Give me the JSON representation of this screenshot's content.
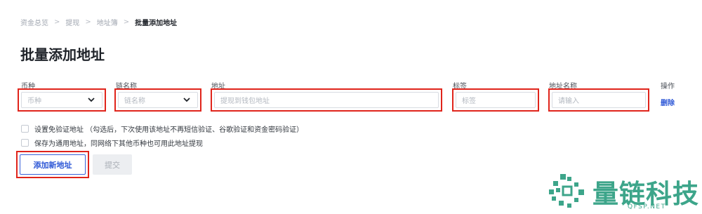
{
  "breadcrumb": {
    "items": [
      "资金总览",
      "提现",
      "地址簿"
    ],
    "separator": ">",
    "current": "批量添加地址"
  },
  "page": {
    "title": "批量添加地址"
  },
  "columns": {
    "coin": "币种",
    "chain": "链名称",
    "address": "地址",
    "tag": "标签",
    "address_name": "地址名称",
    "action": "操作"
  },
  "row": {
    "coin_placeholder": "币种",
    "chain_placeholder": "链名称",
    "address_placeholder": "提现到钱包地址",
    "tag_placeholder": "标签",
    "name_placeholder": "请输入",
    "delete_label": "删除"
  },
  "options": {
    "exempt_verification": "设置免验证地址 （勾选后，下次使用该地址不再短信验证、谷歌验证和资金密码验证）",
    "universal_address": "保存为通用地址，同网络下其他币种也可用此地址提现"
  },
  "buttons": {
    "add_new": "添加新地址",
    "submit": "提交"
  },
  "watermark": {
    "brand": "量链科技",
    "url": "QFSP.NET"
  },
  "colors": {
    "highlight": "#e0241b",
    "link": "#2d57d6",
    "watermark": "#3da58a"
  }
}
